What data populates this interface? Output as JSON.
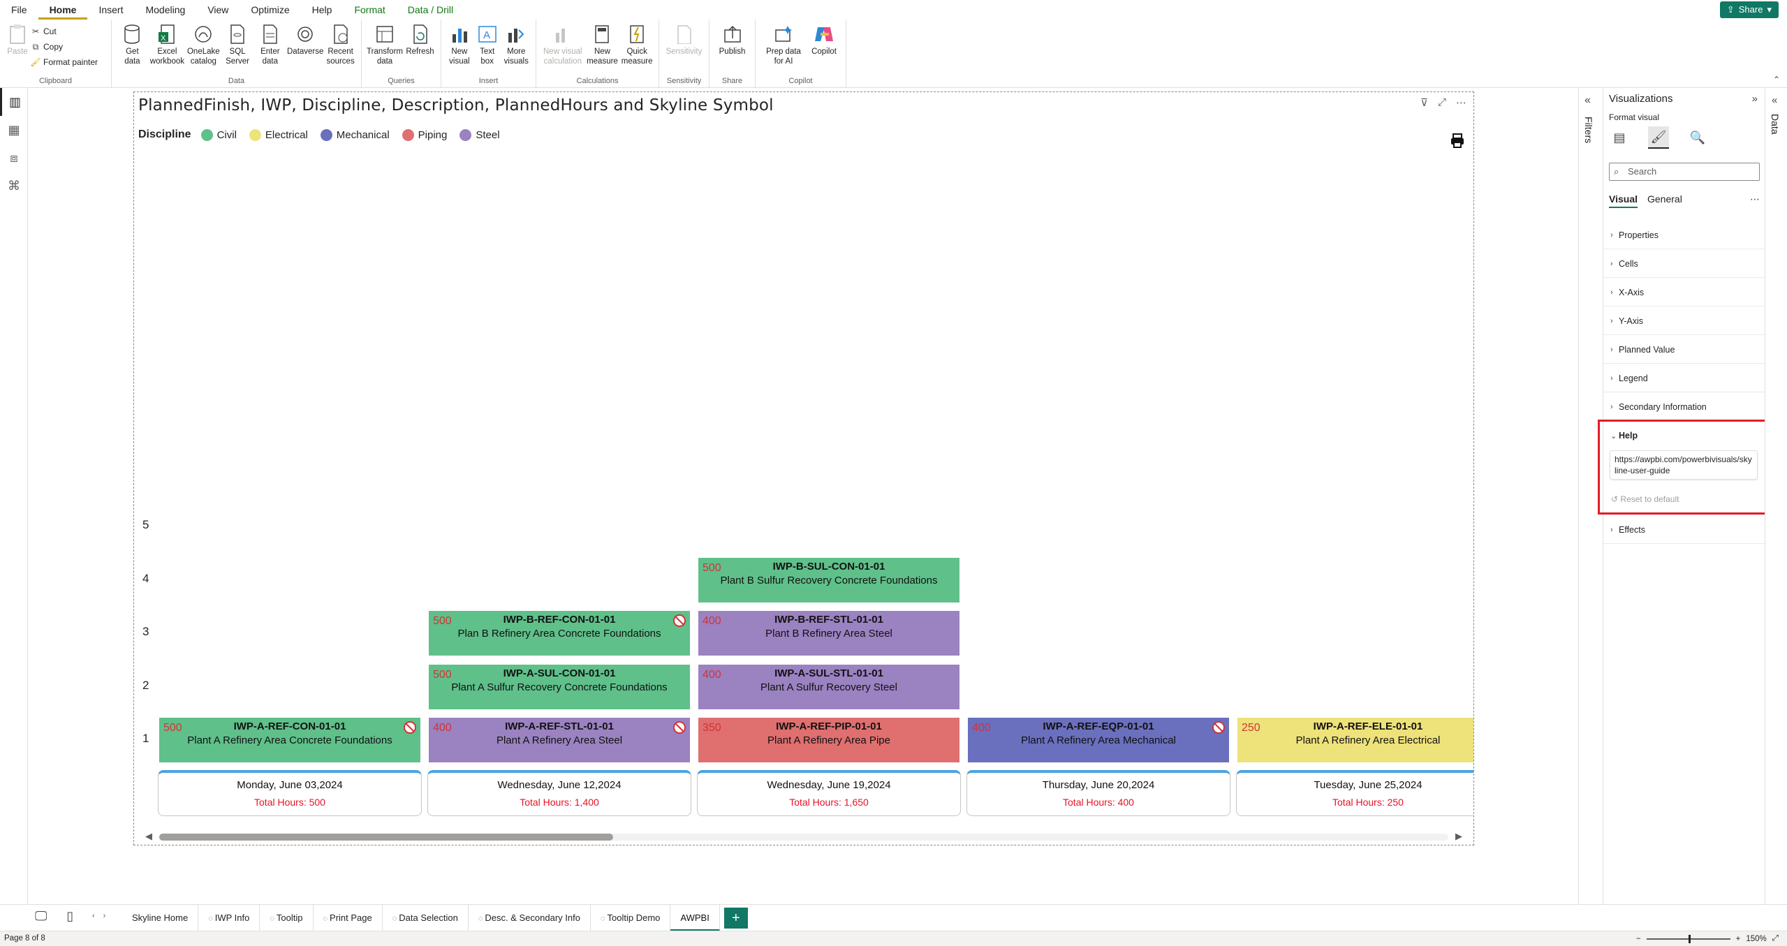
{
  "menu": {
    "items": [
      "File",
      "Home",
      "Insert",
      "Modeling",
      "View",
      "Optimize",
      "Help",
      "Format",
      "Data / Drill"
    ],
    "share_label": "Share"
  },
  "ribbon": {
    "clipboard": {
      "paste": "Paste",
      "cut": "Cut",
      "copy": "Copy",
      "format_painter": "Format painter",
      "group": "Clipboard"
    },
    "data": {
      "get_data": "Get data",
      "excel": "Excel workbook",
      "onelake": "OneLake catalog",
      "sql": "SQL Server",
      "enter": "Enter data",
      "dataverse": "Dataverse",
      "recent": "Recent sources",
      "group": "Data"
    },
    "queries": {
      "transform": "Transform data",
      "refresh": "Refresh",
      "group": "Queries"
    },
    "insert": {
      "new_visual": "New visual",
      "text_box": "Text box",
      "more_visuals": "More visuals",
      "group": "Insert"
    },
    "calculations": {
      "new_visual_calc": "New visual calculation",
      "new_measure": "New measure",
      "quick_measure": "Quick measure",
      "group": "Calculations"
    },
    "sensitivity": {
      "label": "Sensitivity",
      "group": "Sensitivity"
    },
    "share": {
      "publish": "Publish",
      "group": "Share"
    },
    "copilot": {
      "prep": "Prep data for AI",
      "copilot": "Copilot",
      "group": "Copilot"
    }
  },
  "visual": {
    "title": "PlannedFinish, IWP, Discipline, Description, PlannedHours and Skyline Symbol",
    "legend_title": "Discipline",
    "legend": [
      {
        "name": "Civil",
        "color": "#5fc08a"
      },
      {
        "name": "Electrical",
        "color": "#eee27a"
      },
      {
        "name": "Mechanical",
        "color": "#6a6fbe"
      },
      {
        "name": "Piping",
        "color": "#e06f6f"
      },
      {
        "name": "Steel",
        "color": "#9b82c1"
      }
    ]
  },
  "chart_data": {
    "type": "skyline",
    "y_ticks": [
      "1",
      "2",
      "3",
      "4",
      "5"
    ],
    "columns": [
      {
        "date": "Monday, June 03,2024",
        "total": "Total Hours: 500",
        "blocks": [
          {
            "level": 1,
            "hours": "500",
            "id": "IWP-A-REF-CON-01-01",
            "desc": "Plant A Refinery Area Concrete Foundations",
            "discipline": "Civil",
            "blocked": true
          }
        ]
      },
      {
        "date": "Wednesday, June 12,2024",
        "total": "Total Hours: 1,400",
        "blocks": [
          {
            "level": 1,
            "hours": "400",
            "id": "IWP-A-REF-STL-01-01",
            "desc": "Plant A Refinery Area Steel",
            "discipline": "Steel",
            "blocked": true
          },
          {
            "level": 2,
            "hours": "500",
            "id": "IWP-A-SUL-CON-01-01",
            "desc": "Plant A Sulfur Recovery Concrete Foundations",
            "discipline": "Civil",
            "blocked": false
          },
          {
            "level": 3,
            "hours": "500",
            "id": "IWP-B-REF-CON-01-01",
            "desc": "Plan B Refinery Area Concrete Foundations",
            "discipline": "Civil",
            "blocked": true
          }
        ]
      },
      {
        "date": "Wednesday, June 19,2024",
        "total": "Total Hours: 1,650",
        "blocks": [
          {
            "level": 1,
            "hours": "350",
            "id": "IWP-A-REF-PIP-01-01",
            "desc": "Plant A Refinery Area Pipe",
            "discipline": "Piping",
            "blocked": false
          },
          {
            "level": 2,
            "hours": "400",
            "id": "IWP-A-SUL-STL-01-01",
            "desc": "Plant A Sulfur Recovery Steel",
            "discipline": "Steel",
            "blocked": false
          },
          {
            "level": 3,
            "hours": "400",
            "id": "IWP-B-REF-STL-01-01",
            "desc": "Plant B Refinery Area Steel",
            "discipline": "Steel",
            "blocked": false
          },
          {
            "level": 4,
            "hours": "500",
            "id": "IWP-B-SUL-CON-01-01",
            "desc": "Plant B Sulfur Recovery Concrete Foundations",
            "discipline": "Civil",
            "blocked": false
          }
        ]
      },
      {
        "date": "Thursday, June 20,2024",
        "total": "Total Hours: 400",
        "blocks": [
          {
            "level": 1,
            "hours": "400",
            "id": "IWP-A-REF-EQP-01-01",
            "desc": "Plant A Refinery Area Mechanical",
            "discipline": "Mechanical",
            "blocked": true
          }
        ]
      },
      {
        "date": "Tuesday, June 25,2024",
        "total": "Total Hours: 250",
        "blocks": [
          {
            "level": 1,
            "hours": "250",
            "id": "IWP-A-REF-ELE-01-01",
            "desc": "Plant A Refinery Area Electrical",
            "discipline": "Electrical",
            "blocked": false
          }
        ]
      }
    ]
  },
  "filters": {
    "label": "Filters"
  },
  "viz_pane": {
    "title": "Visualizations",
    "subtitle": "Format visual",
    "search_placeholder": "Search",
    "subtabs": [
      "Visual",
      "General"
    ],
    "cards": [
      "Properties",
      "Cells",
      "X-Axis",
      "Y-Axis",
      "Planned Value",
      "Legend",
      "Secondary Information"
    ],
    "help": {
      "label": "Help",
      "url": "https://awpbi.com/powerbivisuals/skyline-user-guide",
      "reset": "Reset to default"
    },
    "effects": "Effects"
  },
  "data_pane": {
    "label": "Data"
  },
  "page_tabs": {
    "tabs": [
      {
        "label": "Skyline Home",
        "hidden": false
      },
      {
        "label": "IWP Info",
        "hidden": true
      },
      {
        "label": "Tooltip",
        "hidden": true
      },
      {
        "label": "Print Page",
        "hidden": true
      },
      {
        "label": "Data Selection",
        "hidden": true
      },
      {
        "label": "Desc. & Secondary Info",
        "hidden": true
      },
      {
        "label": "Tooltip Demo",
        "hidden": true
      },
      {
        "label": "AWPBI",
        "hidden": false,
        "active": true
      }
    ]
  },
  "status": {
    "page": "Page 8 of 8",
    "zoom": "150%"
  }
}
